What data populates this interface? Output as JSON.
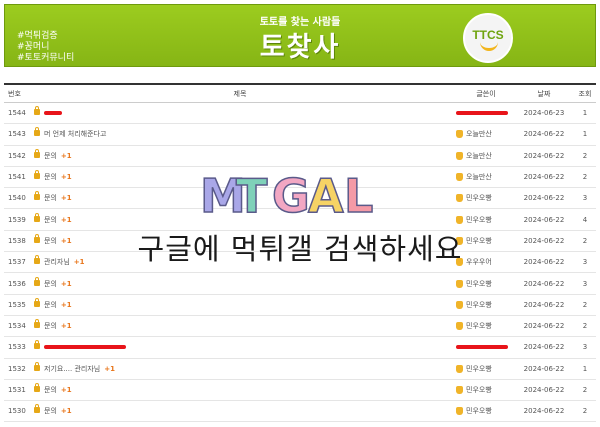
{
  "banner": {
    "tags": [
      "#먹튀검증",
      "#꽁머니",
      "#토토커뮤니티"
    ],
    "subtitle": "토토를 찾는 사람들",
    "title": "토찾사",
    "logo_text": "TTCS"
  },
  "table": {
    "headers": {
      "num": "번호",
      "title": "제목",
      "author": "글쓴이",
      "date": "날짜",
      "views": "조회"
    },
    "rows": [
      {
        "num": "1544",
        "title": "",
        "comments": "",
        "author": "",
        "date": "2024-06-23",
        "views": "1",
        "redact_title": true,
        "redact_author": true
      },
      {
        "num": "1543",
        "title": "머 언제 처리해준다고",
        "comments": "",
        "author": "오늘만산",
        "date": "2024-06-22",
        "views": "1"
      },
      {
        "num": "1542",
        "title": "문의",
        "comments": "+1",
        "author": "오늘만산",
        "date": "2024-06-22",
        "views": "2"
      },
      {
        "num": "1541",
        "title": "문의",
        "comments": "+1",
        "author": "오늘만산",
        "date": "2024-06-22",
        "views": "2"
      },
      {
        "num": "1540",
        "title": "문의",
        "comments": "+1",
        "author": "민우오빵",
        "date": "2024-06-22",
        "views": "3"
      },
      {
        "num": "1539",
        "title": "문의",
        "comments": "+1",
        "author": "민우오빵",
        "date": "2024-06-22",
        "views": "4"
      },
      {
        "num": "1538",
        "title": "문의",
        "comments": "+1",
        "author": "민우오빵",
        "date": "2024-06-22",
        "views": "2"
      },
      {
        "num": "1537",
        "title": "관리자님",
        "comments": "+1",
        "author": "우우우어",
        "date": "2024-06-22",
        "views": "3"
      },
      {
        "num": "1536",
        "title": "문의",
        "comments": "+1",
        "author": "민우오빵",
        "date": "2024-06-22",
        "views": "3"
      },
      {
        "num": "1535",
        "title": "문의",
        "comments": "+1",
        "author": "민우오빵",
        "date": "2024-06-22",
        "views": "2"
      },
      {
        "num": "1534",
        "title": "문의",
        "comments": "+1",
        "author": "민우오빵",
        "date": "2024-06-22",
        "views": "2"
      },
      {
        "num": "1533",
        "title": "",
        "comments": "",
        "author": "",
        "date": "2024-06-22",
        "views": "3",
        "redact_title": true,
        "redact_author": true
      },
      {
        "num": "1532",
        "title": "저기요.... 관리자님",
        "comments": "+1",
        "author": "민우오빵",
        "date": "2024-06-22",
        "views": "1"
      },
      {
        "num": "1531",
        "title": "문의",
        "comments": "+1",
        "author": "민우오빵",
        "date": "2024-06-22",
        "views": "2"
      },
      {
        "num": "1530",
        "title": "문의",
        "comments": "+1",
        "author": "민우오빵",
        "date": "2024-06-22",
        "views": "2"
      }
    ]
  },
  "watermark": {
    "logo_text": "MTGAL",
    "caption": "구글에 먹튀갤 검색하세요",
    "colors": [
      "#a9a7e8",
      "#7fd1b9",
      "#f2a7c3",
      "#f6d365",
      "#f49aa6"
    ]
  }
}
